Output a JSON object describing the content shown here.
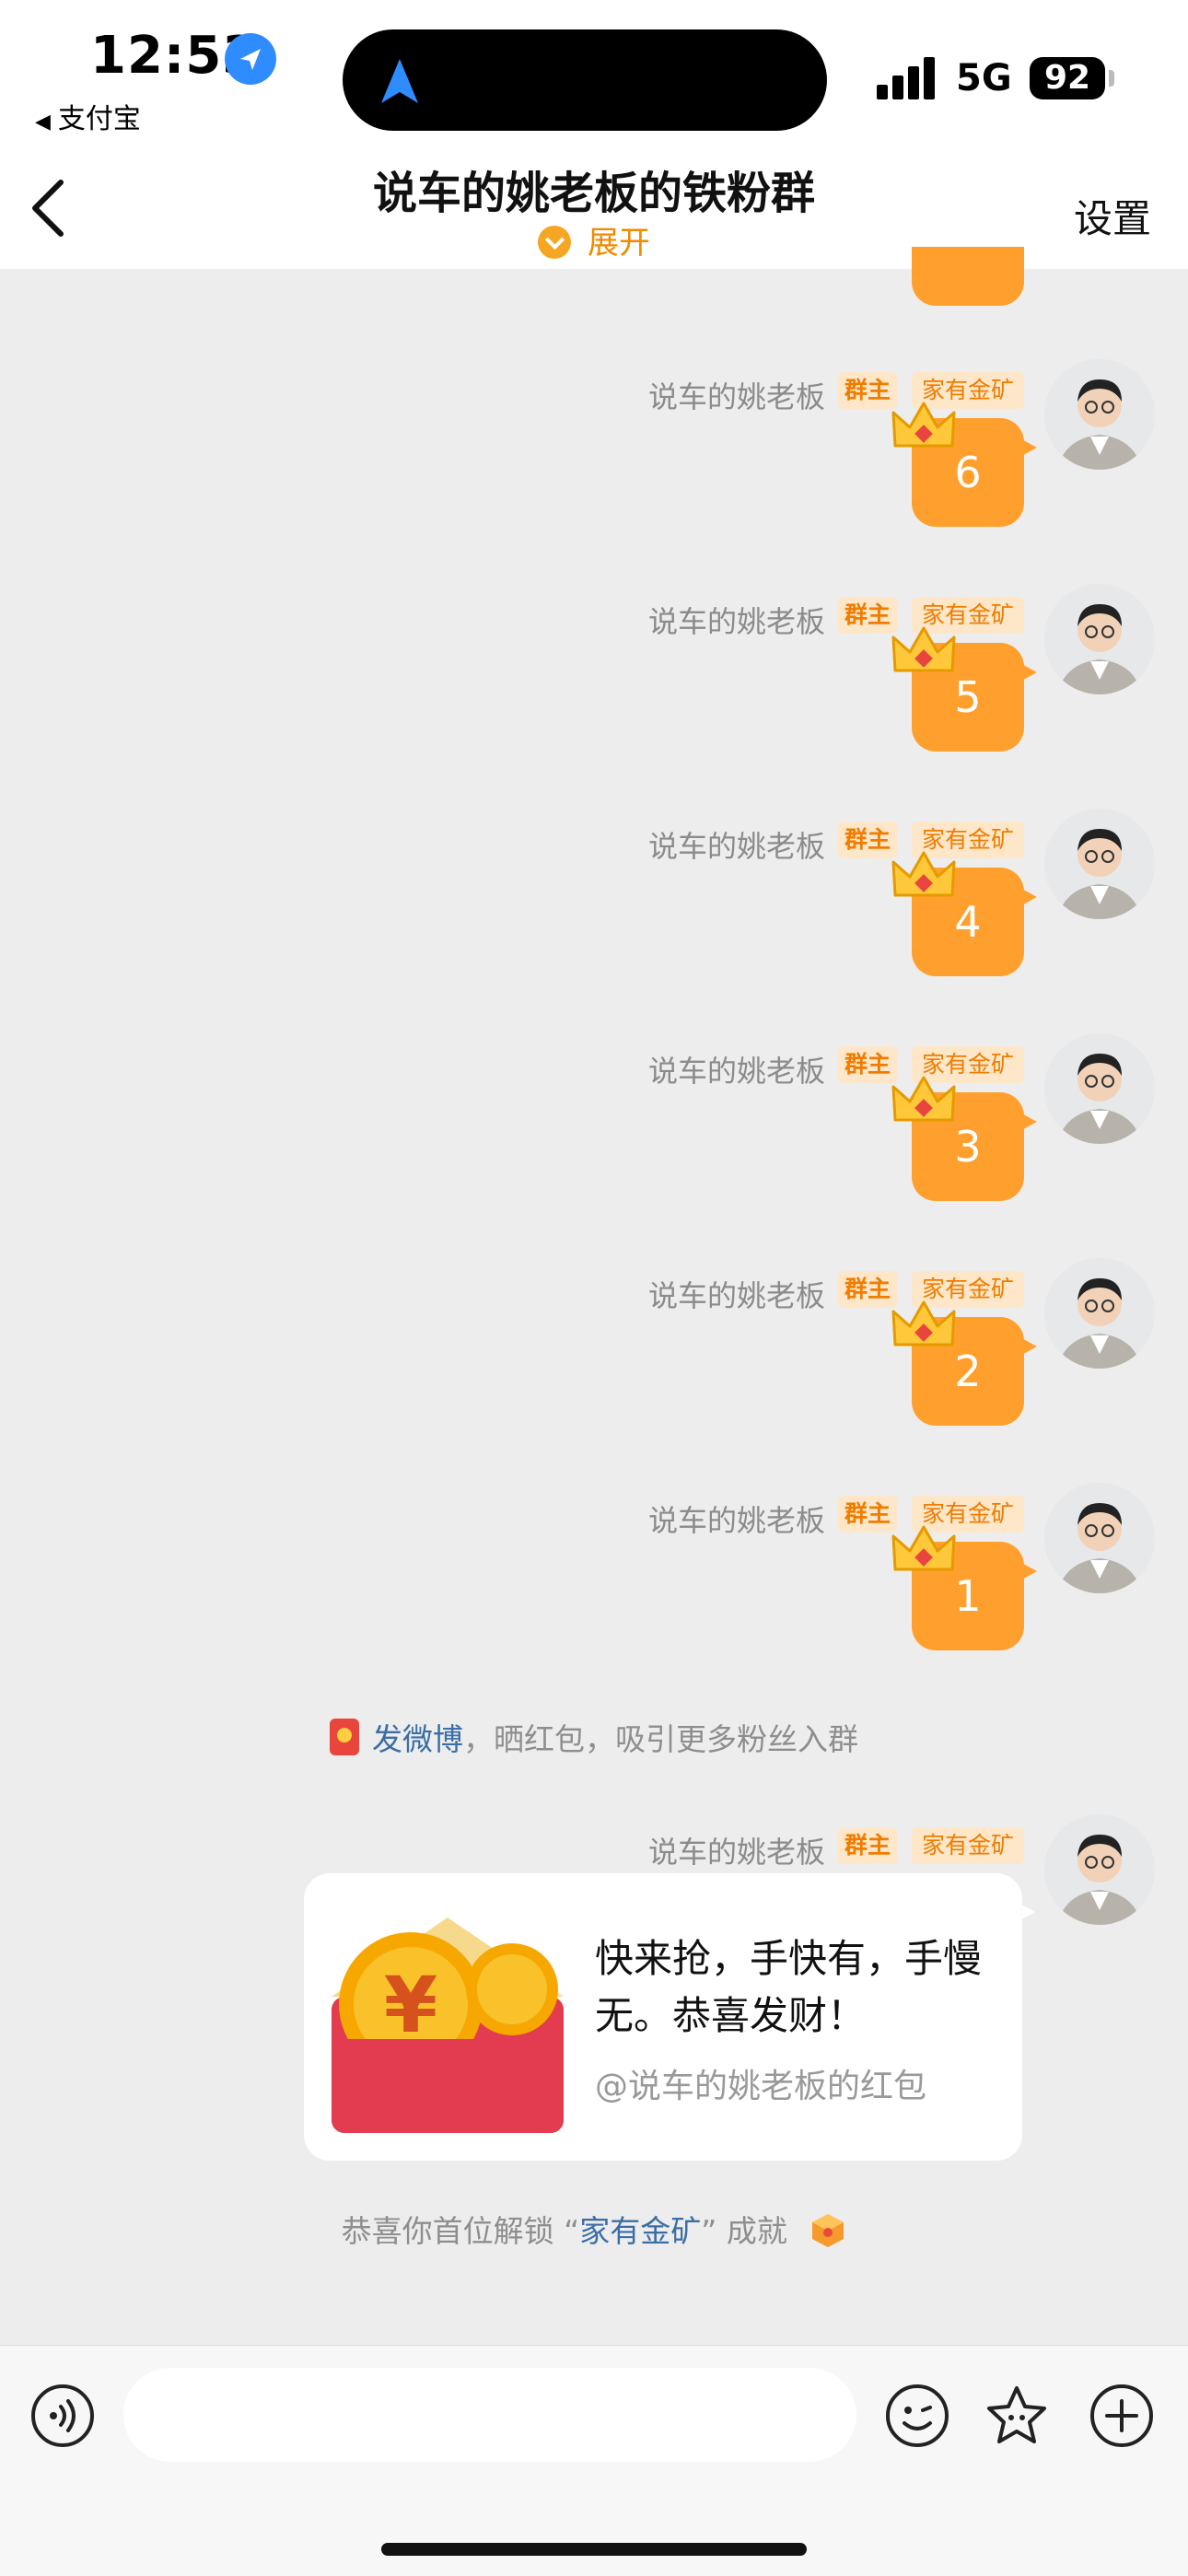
{
  "status_bar": {
    "time": "12:53",
    "back_app": "支付宝",
    "network": "5G",
    "battery": "92"
  },
  "header": {
    "title": "说车的姚老板的铁粉群",
    "expand_label": "展开",
    "settings_label": "设置"
  },
  "messages": [
    {
      "sender": "说车的姚老板",
      "role_badge": "群主",
      "title_badge": "家有金矿",
      "text": "6"
    },
    {
      "sender": "说车的姚老板",
      "role_badge": "群主",
      "title_badge": "家有金矿",
      "text": "5"
    },
    {
      "sender": "说车的姚老板",
      "role_badge": "群主",
      "title_badge": "家有金矿",
      "text": "4"
    },
    {
      "sender": "说车的姚老板",
      "role_badge": "群主",
      "title_badge": "家有金矿",
      "text": "3"
    },
    {
      "sender": "说车的姚老板",
      "role_badge": "群主",
      "title_badge": "家有金矿",
      "text": "2"
    },
    {
      "sender": "说车的姚老板",
      "role_badge": "群主",
      "title_badge": "家有金矿",
      "text": "1"
    },
    {
      "sender": "说车的姚老板",
      "role_badge": "群主",
      "title_badge": "家有金矿"
    }
  ],
  "system_notice_weibo": {
    "link": "发微博",
    "rest": "，晒红包，吸引更多粉丝入群"
  },
  "red_packet": {
    "message": "快来抢，手快有，手慢无。恭喜发财！",
    "subtitle": "@说车的姚老板的红包"
  },
  "achievement_notice": {
    "prefix": "恭喜你首位解锁 “",
    "highlight": "家有金矿",
    "suffix": "” 成就"
  },
  "colors": {
    "accent_orange": "#ffa02e",
    "badge_text": "#f07c00",
    "link_blue": "#3b6ea6",
    "chat_background": "#ededed"
  },
  "icons": {
    "voice": "voice-icon",
    "emoji": "emoji-icon",
    "sticker": "sticker-icon",
    "plus": "plus-icon",
    "back": "back-icon",
    "crown": "crown-icon"
  }
}
